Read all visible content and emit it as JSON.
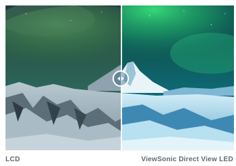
{
  "comparison": {
    "left_label": "LCD",
    "right_label": "ViewSonic Direct View LED",
    "handle_icon": "left-right-arrows-icon"
  },
  "colors": {
    "label": "#5f6a73",
    "divider": "#ffffff"
  }
}
